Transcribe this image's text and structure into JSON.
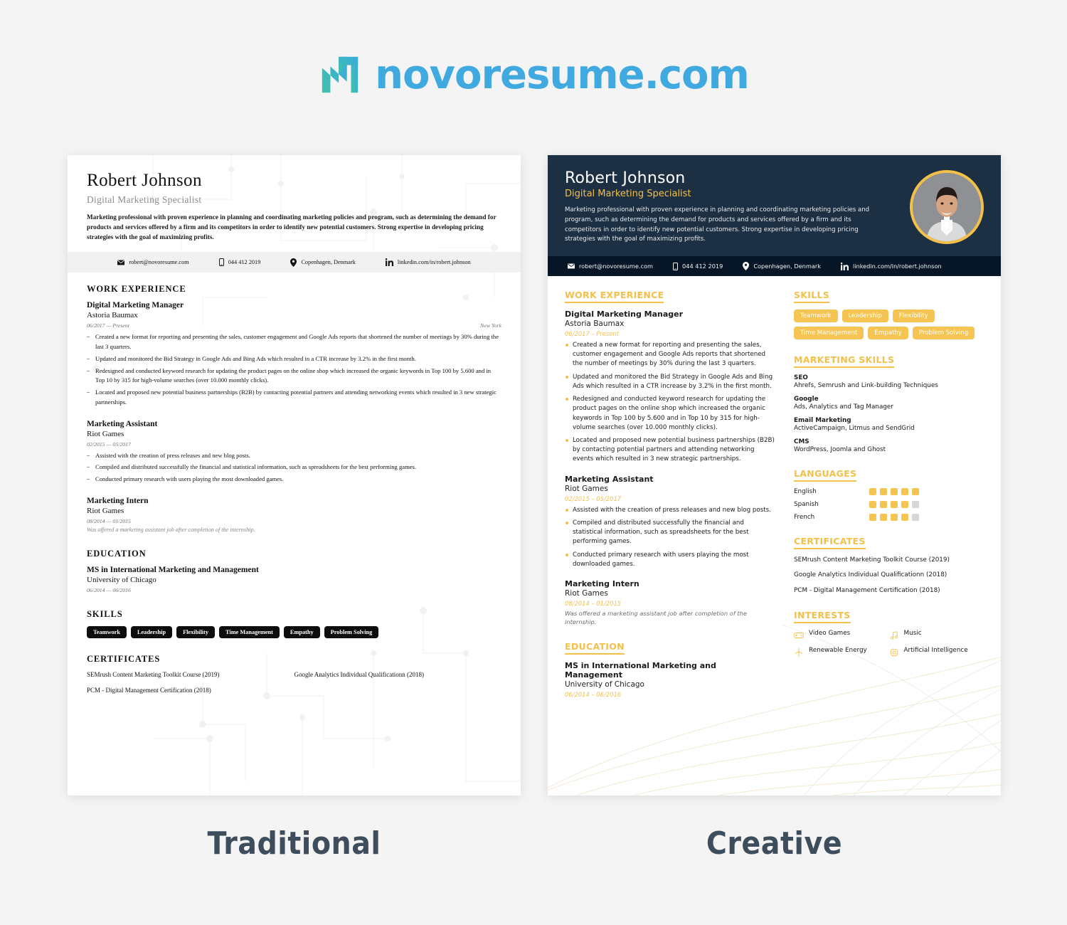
{
  "brand": {
    "name": "novoresume.com",
    "logo_icon": "novoresume-n-logo",
    "color": "#3fa9e0"
  },
  "captions": {
    "traditional": "Traditional",
    "creative": "Creative"
  },
  "theme": {
    "gold": "#f3c04a",
    "pill_gold": "#f6c453",
    "navy": "#1d2f43",
    "navy_dark": "#061626",
    "caption_color": "#3d4d5c"
  },
  "person": {
    "name": "Robert Johnson",
    "role": "Digital Marketing Specialist",
    "summary_traditional": "Marketing professional with proven experience in planning and coordinating marketing policies and program, such as determining the demand for products and services offered by a firm and its competitors in order to identify new potential customers. Strong expertise in developing pricing strategies with the goal of maximizing profits.",
    "summary_creative": "Marketing professional with proven experience in planning and coordinating marketing policies and program, such as determining the demand for products and services offered by a firm and its competitors in order to identify new potential customers. Strong expertise in developing pricing strategies with the goal of maximizing profits."
  },
  "contact": {
    "email": "robert@novoresume.com",
    "phone": "044 412 2019",
    "location": "Copenhagen, Denmark",
    "linkedin": "linkedin.com/in/robert.johnson",
    "icons": [
      "envelope-icon",
      "phone-icon",
      "map-pin-icon",
      "linkedin-icon"
    ]
  },
  "sections": {
    "work_experience": "WORK EXPERIENCE",
    "education": "EDUCATION",
    "skills": "SKILLS",
    "certificates": "CERTIFICATES",
    "marketing_skills": "MARKETING SKILLS",
    "languages": "LANGUAGES",
    "interests": "INTERESTS"
  },
  "jobs": [
    {
      "title": "Digital Marketing Manager",
      "company": "Astoria Baumax",
      "date_traditional": "06/2017 — Present",
      "date_creative": "06/2017 – Present",
      "location": "New York",
      "bullets": [
        "Created a new format for reporting and presenting the sales, customer engagement and Google Ads reports that shortened the number of meetings by 30% during the last 3 quarters.",
        "Updated and monitored the Bid Strategy in Google Ads and Bing Ads which resulted in a CTR increase by 3.2% in the first month.",
        "Redesigned and conducted keyword research for updating the product pages on the online shop which increased the organic keywords in Top 100 by 5.600 and in Top 10 by 315 for high-volume searches (over 10.000 monthly clicks).",
        "Located and proposed new potential business partnerships (B2B) by contacting potential partners and attending networking events which resulted in 3 new strategic partnerships."
      ]
    },
    {
      "title": "Marketing Assistant",
      "company": "Riot Games",
      "date_traditional": "02/2015 — 05/2017",
      "date_creative": "02/2015 – 05/2017",
      "location": "",
      "bullets": [
        "Assisted with the creation of press releases and new blog posts.",
        "Compiled and distributed successfully the financial and statistical information, such as spreadsheets for the best performing games.",
        "Conducted primary research with users playing the most downloaded games."
      ]
    },
    {
      "title": "Marketing Intern",
      "company": "Riot Games",
      "date_traditional": "08/2014 — 01/2015",
      "date_creative": "08/2014 – 01/2015",
      "location": "",
      "bullets": [],
      "note": "Was offered a marketing assistant job after completion of the internship."
    }
  ],
  "education": {
    "degree": "MS in International Marketing and Management",
    "school": "University of Chicago",
    "date_traditional": "06/2014 — 06/2016",
    "date_creative": "06/2014 – 06/2016"
  },
  "skills": [
    "Teamwork",
    "Leadership",
    "Flexibility",
    "Time Management",
    "Empathy",
    "Problem Solving"
  ],
  "certificates": [
    "SEMrush Content Marketing Toolkit Course (2019)",
    "Google Analytics Individual Qualificationn (2018)",
    "PCM - Digital Management Certification (2018)"
  ],
  "marketing_skills": [
    {
      "title": "SEO",
      "detail": "Ahrefs, Semrush and Link-building Techniques"
    },
    {
      "title": "Google",
      "detail": "Ads, Analytics and Tag Manager"
    },
    {
      "title": "Email Marketing",
      "detail": "ActiveCampaign, Litmus and SendGrid"
    },
    {
      "title": "CMS",
      "detail": "WordPress, Joomla and Ghost"
    }
  ],
  "languages": [
    {
      "name": "English",
      "level": 5,
      "max": 5
    },
    {
      "name": "Spanish",
      "level": 4,
      "max": 5
    },
    {
      "name": "French",
      "level": 4,
      "max": 5
    }
  ],
  "interests": [
    {
      "label": "Video Games",
      "icon": "gamepad-icon"
    },
    {
      "label": "Music",
      "icon": "music-note-icon"
    },
    {
      "label": "Renewable Energy",
      "icon": "wind-turbine-icon"
    },
    {
      "label": "Artificial Intelligence",
      "icon": "cpu-chip-icon"
    }
  ]
}
